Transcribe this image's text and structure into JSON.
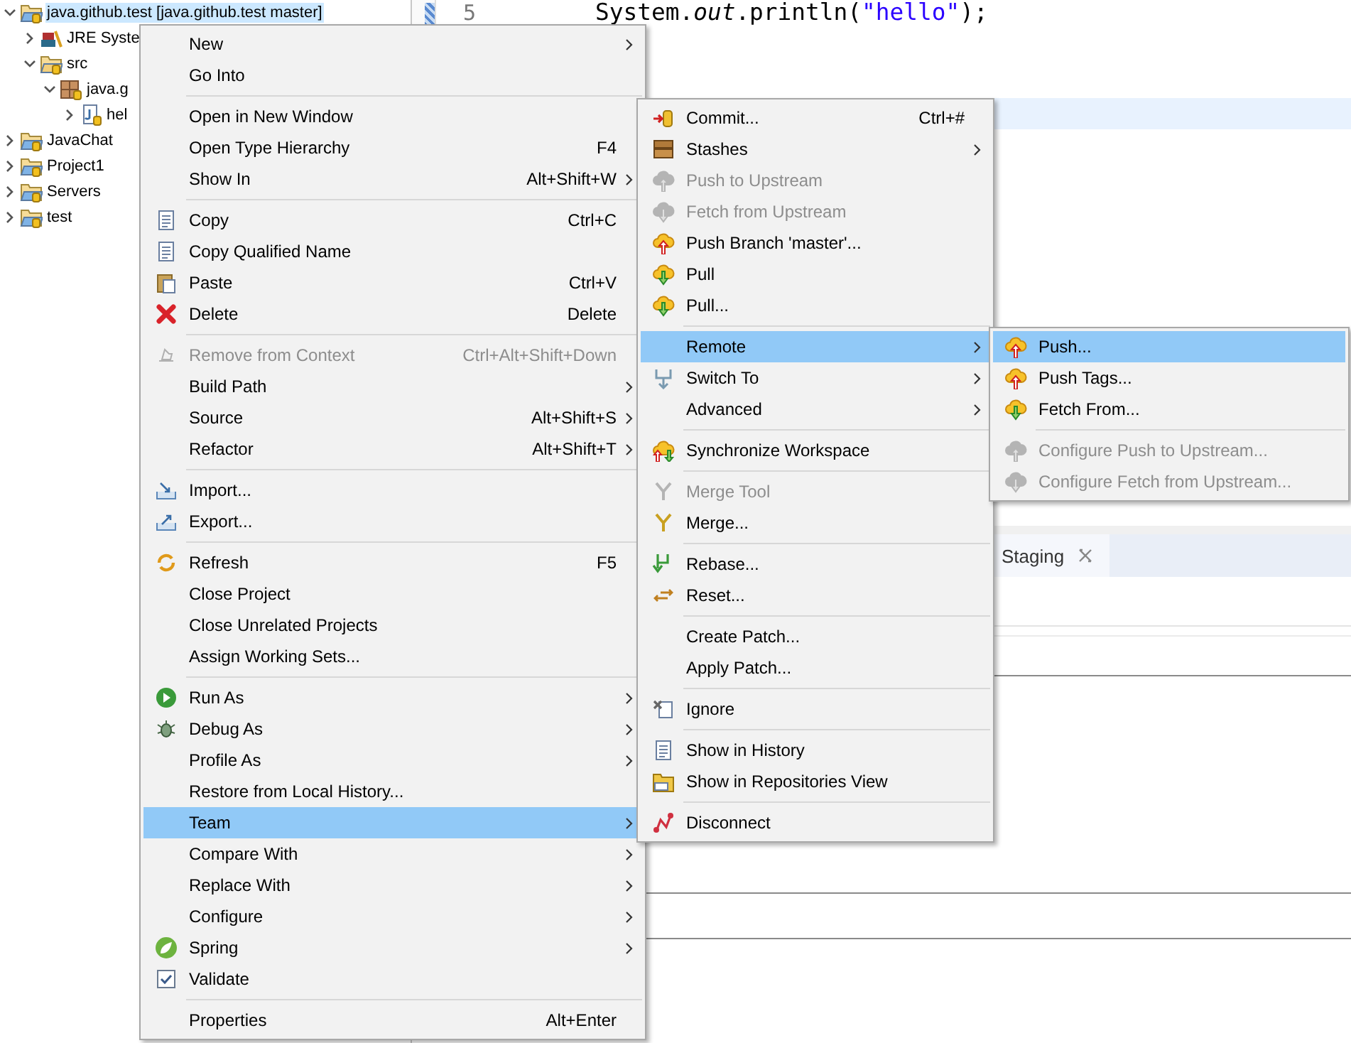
{
  "explorer": {
    "items": [
      {
        "label": "java.github.test [java.github.test master]",
        "selected": true,
        "expanded": true,
        "children": [
          {
            "label": "JRE Syste",
            "selected": false,
            "expanded": false
          },
          {
            "label": "src",
            "selected": false,
            "expanded": true,
            "children": [
              {
                "label": "java.g",
                "selected": false,
                "expanded": true,
                "children": [
                  {
                    "label": "hel",
                    "selected": false,
                    "expanded": false
                  }
                ]
              }
            ]
          }
        ]
      },
      {
        "label": "JavaChat",
        "selected": false,
        "expanded": false
      },
      {
        "label": "Project1",
        "selected": false,
        "expanded": false
      },
      {
        "label": "Servers",
        "selected": false,
        "expanded": false
      },
      {
        "label": "test",
        "selected": false,
        "expanded": false
      }
    ]
  },
  "editor": {
    "lines": [
      {
        "number": "5",
        "code": "System.*out*.println(\"hello\");"
      }
    ]
  },
  "bottom_panel": {
    "tabs": [
      {
        "label": "Staging"
      }
    ]
  },
  "menus": [
    {
      "items": [
        {
          "kind": "item",
          "label": "New",
          "submenu": true,
          "disabled": false,
          "selected": false
        },
        {
          "kind": "item",
          "label": "Go Into",
          "submenu": false,
          "disabled": false,
          "selected": false
        },
        {
          "kind": "separator"
        },
        {
          "kind": "item",
          "label": "Open in New Window",
          "submenu": false,
          "disabled": false,
          "selected": false
        },
        {
          "kind": "item",
          "label": "Open Type Hierarchy",
          "shortcut": "F4",
          "submenu": false,
          "disabled": false,
          "selected": false
        },
        {
          "kind": "item",
          "label": "Show In",
          "shortcut": "Alt+Shift+W",
          "submenu": true,
          "disabled": false,
          "selected": false
        },
        {
          "kind": "separator"
        },
        {
          "kind": "item",
          "label": "Copy",
          "shortcut": "Ctrl+C",
          "submenu": false,
          "disabled": false,
          "selected": false
        },
        {
          "kind": "item",
          "label": "Copy Qualified Name",
          "submenu": false,
          "disabled": false,
          "selected": false
        },
        {
          "kind": "item",
          "label": "Paste",
          "shortcut": "Ctrl+V",
          "submenu": false,
          "disabled": false,
          "selected": false
        },
        {
          "kind": "item",
          "label": "Delete",
          "shortcut": "Delete",
          "submenu": false,
          "disabled": false,
          "selected": false
        },
        {
          "kind": "separator"
        },
        {
          "kind": "item",
          "label": "Remove from Context",
          "shortcut": "Ctrl+Alt+Shift+Down",
          "submenu": false,
          "disabled": true,
          "selected": false
        },
        {
          "kind": "item",
          "label": "Build Path",
          "submenu": true,
          "disabled": false,
          "selected": false
        },
        {
          "kind": "item",
          "label": "Source",
          "shortcut": "Alt+Shift+S",
          "submenu": true,
          "disabled": false,
          "selected": false
        },
        {
          "kind": "item",
          "label": "Refactor",
          "shortcut": "Alt+Shift+T",
          "submenu": true,
          "disabled": false,
          "selected": false
        },
        {
          "kind": "separator"
        },
        {
          "kind": "item",
          "label": "Import...",
          "submenu": false,
          "disabled": false,
          "selected": false
        },
        {
          "kind": "item",
          "label": "Export...",
          "submenu": false,
          "disabled": false,
          "selected": false
        },
        {
          "kind": "separator"
        },
        {
          "kind": "item",
          "label": "Refresh",
          "shortcut": "F5",
          "submenu": false,
          "disabled": false,
          "selected": false
        },
        {
          "kind": "item",
          "label": "Close Project",
          "submenu": false,
          "disabled": false,
          "selected": false
        },
        {
          "kind": "item",
          "label": "Close Unrelated Projects",
          "submenu": false,
          "disabled": false,
          "selected": false
        },
        {
          "kind": "item",
          "label": "Assign Working Sets...",
          "submenu": false,
          "disabled": false,
          "selected": false
        },
        {
          "kind": "separator"
        },
        {
          "kind": "item",
          "label": "Run As",
          "submenu": true,
          "disabled": false,
          "selected": false
        },
        {
          "kind": "item",
          "label": "Debug As",
          "submenu": true,
          "disabled": false,
          "selected": false
        },
        {
          "kind": "item",
          "label": "Profile As",
          "submenu": true,
          "disabled": false,
          "selected": false
        },
        {
          "kind": "item",
          "label": "Restore from Local History...",
          "submenu": false,
          "disabled": false,
          "selected": false
        },
        {
          "kind": "item",
          "label": "Team",
          "submenu": true,
          "disabled": false,
          "selected": true
        },
        {
          "kind": "item",
          "label": "Compare With",
          "submenu": true,
          "disabled": false,
          "selected": false
        },
        {
          "kind": "item",
          "label": "Replace With",
          "submenu": true,
          "disabled": false,
          "selected": false
        },
        {
          "kind": "item",
          "label": "Configure",
          "submenu": true,
          "disabled": false,
          "selected": false
        },
        {
          "kind": "item",
          "label": "Spring",
          "submenu": true,
          "disabled": false,
          "selected": false
        },
        {
          "kind": "item",
          "label": "Validate",
          "submenu": false,
          "disabled": false,
          "selected": false
        },
        {
          "kind": "separator"
        },
        {
          "kind": "item",
          "label": "Properties",
          "shortcut": "Alt+Enter",
          "submenu": false,
          "disabled": false,
          "selected": false
        }
      ]
    },
    {
      "items": [
        {
          "kind": "item",
          "label": "Commit...",
          "shortcut": "Ctrl+#",
          "submenu": false,
          "disabled": false,
          "selected": false
        },
        {
          "kind": "item",
          "label": "Stashes",
          "submenu": true,
          "disabled": false,
          "selected": false
        },
        {
          "kind": "item",
          "label": "Push to Upstream",
          "submenu": false,
          "disabled": true,
          "selected": false
        },
        {
          "kind": "item",
          "label": "Fetch from Upstream",
          "submenu": false,
          "disabled": true,
          "selected": false
        },
        {
          "kind": "item",
          "label": "Push Branch 'master'...",
          "submenu": false,
          "disabled": false,
          "selected": false
        },
        {
          "kind": "item",
          "label": "Pull",
          "submenu": false,
          "disabled": false,
          "selected": false
        },
        {
          "kind": "item",
          "label": "Pull...",
          "submenu": false,
          "disabled": false,
          "selected": false
        },
        {
          "kind": "separator"
        },
        {
          "kind": "item",
          "label": "Remote",
          "submenu": true,
          "disabled": false,
          "selected": true
        },
        {
          "kind": "item",
          "label": "Switch To",
          "submenu": true,
          "disabled": false,
          "selected": false
        },
        {
          "kind": "item",
          "label": "Advanced",
          "submenu": true,
          "disabled": false,
          "selected": false
        },
        {
          "kind": "separator"
        },
        {
          "kind": "item",
          "label": "Synchronize Workspace",
          "submenu": false,
          "disabled": false,
          "selected": false
        },
        {
          "kind": "separator"
        },
        {
          "kind": "item",
          "label": "Merge Tool",
          "submenu": false,
          "disabled": true,
          "selected": false
        },
        {
          "kind": "item",
          "label": "Merge...",
          "submenu": false,
          "disabled": false,
          "selected": false
        },
        {
          "kind": "separator"
        },
        {
          "kind": "item",
          "label": "Rebase...",
          "submenu": false,
          "disabled": false,
          "selected": false
        },
        {
          "kind": "item",
          "label": "Reset...",
          "submenu": false,
          "disabled": false,
          "selected": false
        },
        {
          "kind": "separator"
        },
        {
          "kind": "item",
          "label": "Create Patch...",
          "submenu": false,
          "disabled": false,
          "selected": false
        },
        {
          "kind": "item",
          "label": "Apply Patch...",
          "submenu": false,
          "disabled": false,
          "selected": false
        },
        {
          "kind": "separator"
        },
        {
          "kind": "item",
          "label": "Ignore",
          "submenu": false,
          "disabled": false,
          "selected": false
        },
        {
          "kind": "separator"
        },
        {
          "kind": "item",
          "label": "Show in History",
          "submenu": false,
          "disabled": false,
          "selected": false
        },
        {
          "kind": "item",
          "label": "Show in Repositories View",
          "submenu": false,
          "disabled": false,
          "selected": false
        },
        {
          "kind": "separator"
        },
        {
          "kind": "item",
          "label": "Disconnect",
          "submenu": false,
          "disabled": false,
          "selected": false
        }
      ]
    },
    {
      "items": [
        {
          "kind": "item",
          "label": "Push...",
          "submenu": false,
          "disabled": false,
          "selected": true
        },
        {
          "kind": "item",
          "label": "Push Tags...",
          "submenu": false,
          "disabled": false,
          "selected": false
        },
        {
          "kind": "item",
          "label": "Fetch From...",
          "submenu": false,
          "disabled": false,
          "selected": false
        },
        {
          "kind": "separator"
        },
        {
          "kind": "item",
          "label": "Configure Push to Upstream...",
          "submenu": false,
          "disabled": true,
          "selected": false
        },
        {
          "kind": "item",
          "label": "Configure Fetch from Upstream...",
          "submenu": false,
          "disabled": true,
          "selected": false
        }
      ]
    }
  ]
}
